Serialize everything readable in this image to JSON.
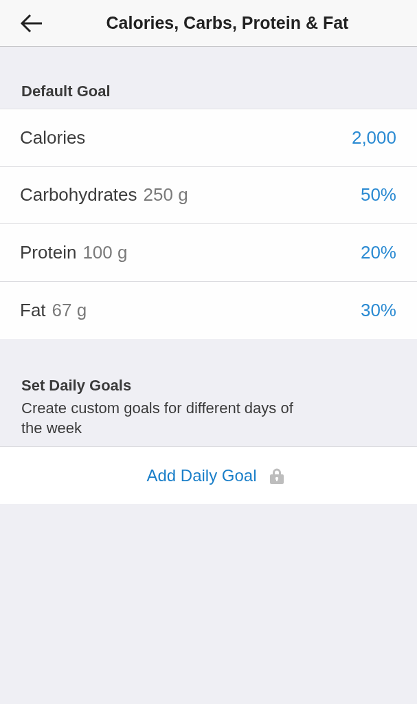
{
  "header": {
    "title": "Calories, Carbs, Protein & Fat"
  },
  "default_goal": {
    "heading": "Default Goal",
    "rows": [
      {
        "label": "Calories",
        "value": "2,000"
      },
      {
        "label": "Carbohydrates",
        "amount": "250 g",
        "value": "50%"
      },
      {
        "label": "Protein",
        "amount": "100 g",
        "value": "20%"
      },
      {
        "label": "Fat",
        "amount": "67 g",
        "value": "30%"
      }
    ]
  },
  "daily_goals": {
    "heading": "Set Daily Goals",
    "description": "Create custom goals for different days of the week",
    "add_button": {
      "label": "Add Daily Goal",
      "locked": true
    }
  }
}
